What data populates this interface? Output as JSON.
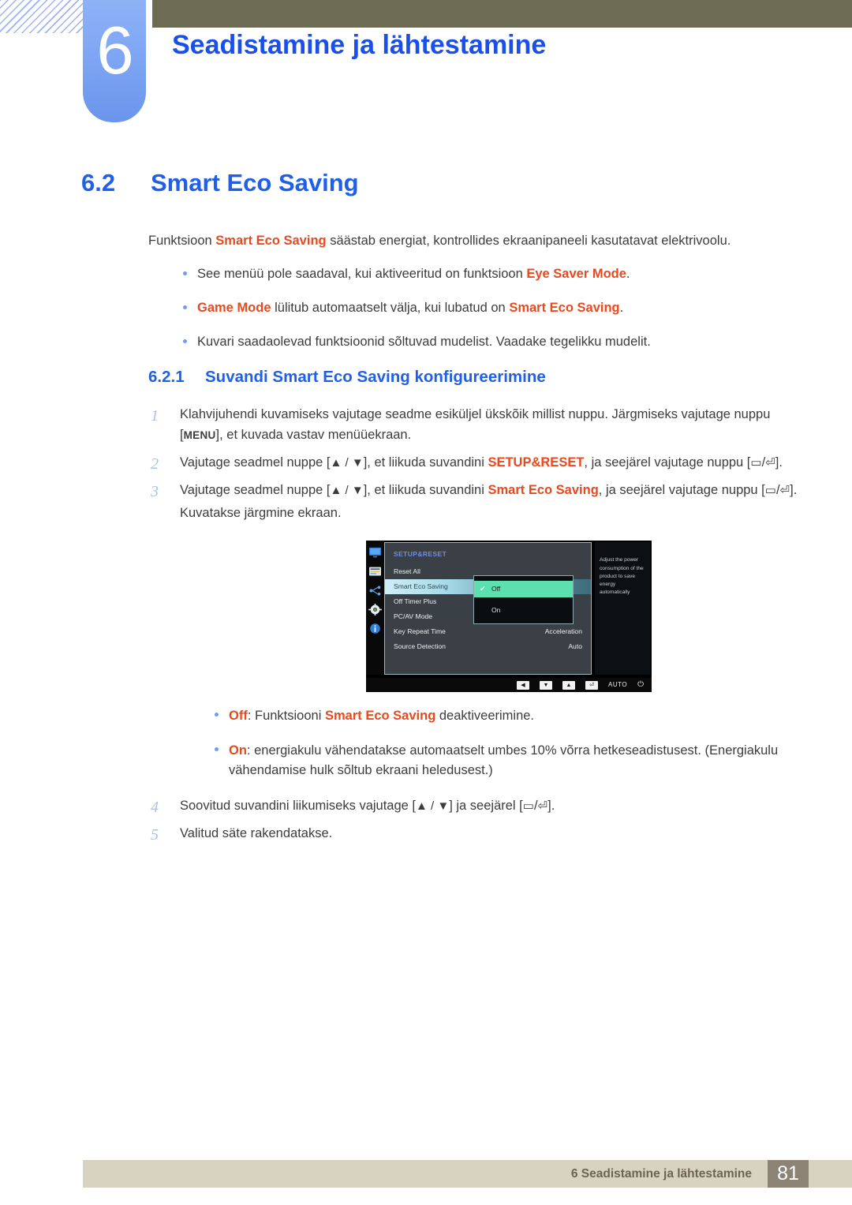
{
  "header": {
    "chapter_number": "6",
    "chapter_title": "Seadistamine ja lähtestamine",
    "bar_color": "#6e6b55",
    "tab_color": "#7ea6f4"
  },
  "section": {
    "number": "6.2",
    "title": "Smart Eco Saving",
    "color": "#2060e8"
  },
  "intro": {
    "before": "Funktsioon ",
    "highlight": "Smart Eco Saving",
    "after": " säästab energiat, kontrollides ekraanipaneeli kasutatavat elektrivoolu."
  },
  "notes": [
    {
      "before": "See menüü pole saadaval, kui aktiveeritud on funktsioon ",
      "highlight": "Eye Saver Mode",
      "after": "."
    },
    {
      "before": "",
      "highlight": "Game Mode",
      "mid": " lülitub automaatselt välja, kui lubatud on ",
      "highlight2": "Smart Eco Saving",
      "after": "."
    },
    {
      "plain": "Kuvari saadaolevad funktsioonid sõltuvad mudelist. Vaadake tegelikku mudelit."
    }
  ],
  "subsection": {
    "number": "6.2.1",
    "title": "Suvandi Smart Eco Saving konfigureerimine"
  },
  "steps": [
    {
      "num": "1",
      "p1": "Klahvijuhendi kuvamiseks vajutage seadme esiküljel ükskõik millist nuppu. Järgmiseks vajutage nuppu [",
      "key": "MENU",
      "p2": "], et kuvada vastav menüüekraan."
    },
    {
      "num": "2",
      "p1": "Vajutage seadmel nuppe [",
      "arrows": "▲ / ▼",
      "p2": "], et liikuda suvandini ",
      "highlight": "SETUP&RESET",
      "p3": ", ja seejärel vajutage nuppu [",
      "glyph1": "▭",
      "sep": "/",
      "glyph2": "⏎",
      "p4": "]."
    },
    {
      "num": "3",
      "p1": "Vajutage seadmel nuppe [",
      "arrows": "▲ / ▼",
      "p2": "], et liikuda suvandini ",
      "highlight": "Smart Eco Saving",
      "p3": ", ja seejärel vajutage nuppu [",
      "glyph1": "▭",
      "sep": "/",
      "glyph2": "⏎",
      "p4": "].",
      "note": "Kuvatakse järgmine ekraan."
    },
    {
      "num": "4",
      "p1": "Soovitud suvandini liikumiseks vajutage [",
      "arrows": "▲ / ▼",
      "p2": "] ja seejärel [",
      "glyph1": "▭",
      "sep": "/",
      "glyph2": "⏎",
      "p4": "]."
    },
    {
      "num": "5",
      "p1": "Valitud säte rakendatakse."
    }
  ],
  "osd": {
    "category": "SETUP&RESET",
    "help_text": "Adjust the power consumption of the product to save energy automatically",
    "rows": [
      {
        "label": "Reset All",
        "value": "",
        "selected": false
      },
      {
        "label": "Smart Eco Saving",
        "value": "",
        "selected": true
      },
      {
        "label": "Off Timer Plus",
        "value": "",
        "selected": false
      },
      {
        "label": "PC/AV Mode",
        "value": "",
        "selected": false
      },
      {
        "label": "Key Repeat Time",
        "value": "Acceleration",
        "selected": false
      },
      {
        "label": "Source Detection",
        "value": "Auto",
        "selected": false
      }
    ],
    "submenu": [
      {
        "label": "Off",
        "checked": true
      },
      {
        "label": "On",
        "checked": false
      }
    ],
    "check_glyph": "✔",
    "sidebar_icons": [
      "monitor-icon",
      "list-icon",
      "node-icon",
      "gear-icon",
      "info-icon"
    ],
    "bottom_buttons": [
      "◀",
      "▼",
      "▲",
      "⏎"
    ],
    "auto_label": "AUTO",
    "power_glyph": "⏻",
    "highlight_color": "#5de0b0"
  },
  "option_notes": [
    {
      "highlight": "Off",
      "mid": ": Funktsiooni ",
      "highlight2": "Smart Eco Saving",
      "after": " deaktiveerimine."
    },
    {
      "highlight": "On",
      "mid": ": energiakulu vähendatakse automaatselt umbes 10% võrra hetkeseadistusest. (Energiakulu vähendamise hulk sõltub ekraani heledusest.)"
    }
  ],
  "footer": {
    "text": "6 Seadistamine ja lähtestamine",
    "page": "81",
    "bar_color": "#d8d3c0",
    "page_box_color": "#8d8374"
  }
}
